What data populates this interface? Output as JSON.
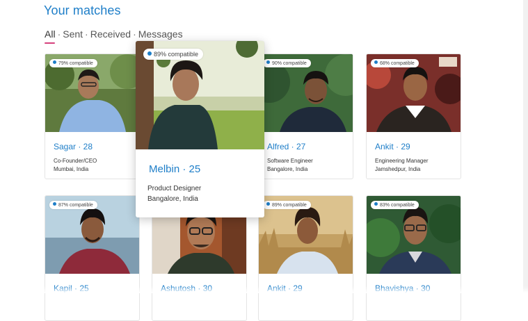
{
  "page": {
    "title": "Your matches",
    "tabs": [
      {
        "label": "All",
        "active": true
      },
      {
        "label": "Sent"
      },
      {
        "label": "Received"
      },
      {
        "label": "Messages"
      }
    ],
    "tab_separator": "·",
    "accent_color": "#1e7ec8",
    "underline_color": "#d6407c"
  },
  "matches": [
    {
      "compat": "79% compatible",
      "name": "Sagar · 28",
      "role": "Co-Founder/CEO",
      "location": "Mumbai, India"
    },
    {
      "compat": "89% compatible",
      "name": "Melbin · 25",
      "role": "Product Designer",
      "location": "Bangalore, India",
      "expanded": true
    },
    {
      "compat": "90% compatible",
      "name": "Alfred · 27",
      "role": "Software Engineer",
      "location": "Bangalore, India"
    },
    {
      "compat": "68% compatible",
      "name": "Ankit · 29",
      "role": "Engineering Manager",
      "location": "Jamshedpur, India"
    },
    {
      "compat": "87% compatible",
      "name": "Kapil · 25"
    },
    {
      "name": "Ashutosh · 30"
    },
    {
      "compat": "89% compatible",
      "name": "Ankit · 29"
    },
    {
      "compat": "83% compatible",
      "name": "Bhavishya · 30"
    }
  ]
}
